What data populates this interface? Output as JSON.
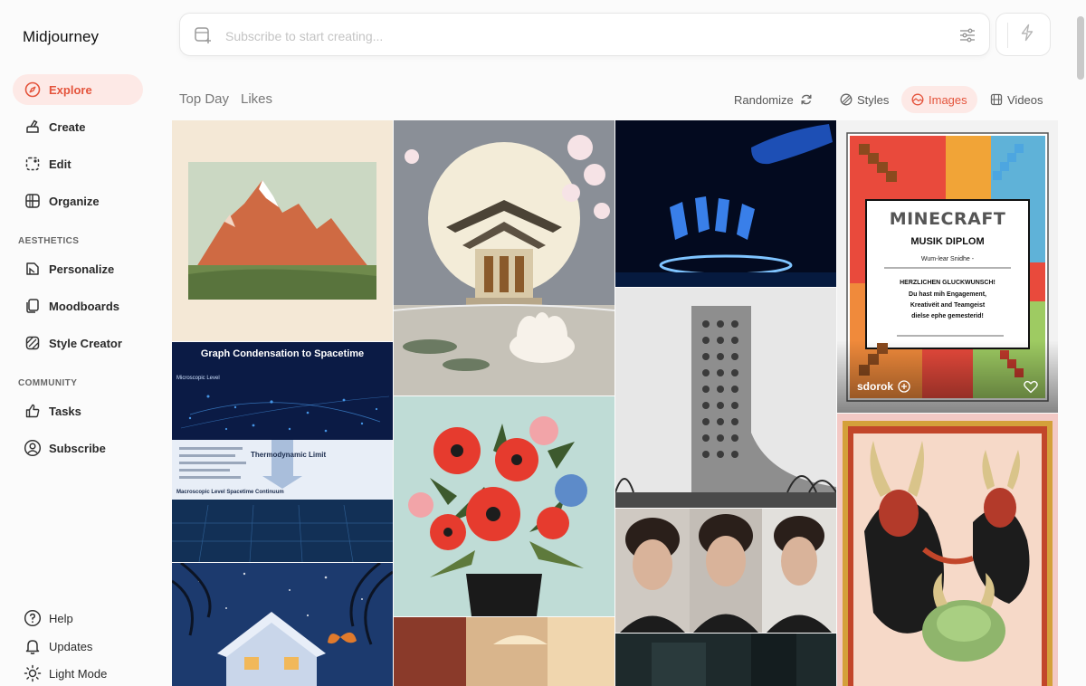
{
  "app": {
    "title": "Midjourney"
  },
  "colors": {
    "accent": "#e4543c",
    "accent_bg": "#fde9e6"
  },
  "sidebar": {
    "main_items": [
      {
        "label": "Explore",
        "icon": "compass-icon",
        "active": true
      },
      {
        "label": "Create",
        "icon": "brush-icon"
      },
      {
        "label": "Edit",
        "icon": "edit-frame-icon"
      },
      {
        "label": "Organize",
        "icon": "grid-icon"
      }
    ],
    "aesthetics_label": "AESTHETICS",
    "aesthetics_items": [
      {
        "label": "Personalize",
        "icon": "personalize-icon"
      },
      {
        "label": "Moodboards",
        "icon": "moodboard-icon"
      },
      {
        "label": "Style Creator",
        "icon": "style-creator-icon"
      }
    ],
    "community_label": "COMMUNITY",
    "community_items": [
      {
        "label": "Tasks",
        "icon": "thumbs-up-icon"
      },
      {
        "label": "Subscribe",
        "icon": "user-circle-icon"
      }
    ],
    "bottom_items": [
      {
        "label": "Help",
        "icon": "help-icon"
      },
      {
        "label": "Updates",
        "icon": "bell-icon"
      },
      {
        "label": "Light Mode",
        "icon": "sun-icon"
      }
    ]
  },
  "search": {
    "placeholder": "Subscribe to start creating..."
  },
  "filters": {
    "tabs": [
      {
        "label": "Top Day"
      },
      {
        "label": "Likes"
      }
    ],
    "randomize": "Randomize",
    "styles": "Styles",
    "images": "Images",
    "videos": "Videos",
    "active": "Images"
  },
  "tiles": {
    "graph_title": "Graph Condensation to Spacetime",
    "graph_level": "Microscopic Level",
    "graph_limit": "Thermodynamic Limit",
    "graph_bottom": "Macroscopic Level Spacetime Continuum",
    "minecraft_logo": "MINECRAFT",
    "minecraft_title": "MUSIK DIPLOM",
    "minecraft_name": "Wum-lear Snidhe -",
    "minecraft_congrats": "HERZLICHEN GLUCKWUNSCH!",
    "minecraft_line1": "Du hast mih Engagement,",
    "minecraft_line2": "Kreativëit and Teamgeist",
    "minecraft_line3": "dielse ephe gemesterid!",
    "hover_user": "sdorok"
  }
}
